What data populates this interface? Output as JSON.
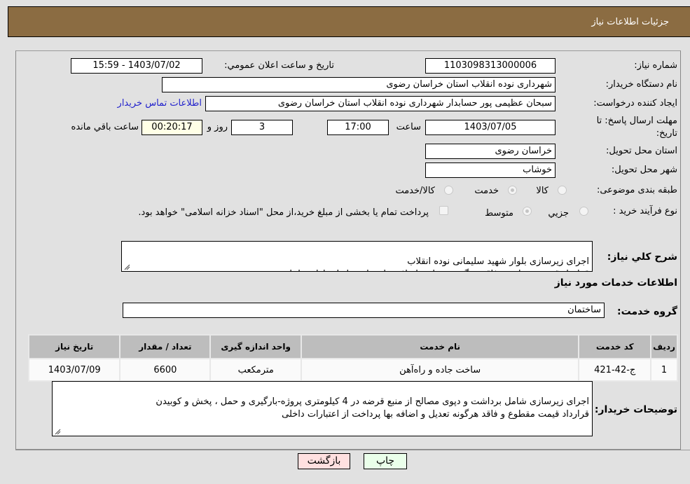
{
  "header": {
    "title": "جزئیات اطلاعات نیاز"
  },
  "fields": {
    "need_number": {
      "label": "شماره نیاز:",
      "value": "1103098313000006"
    },
    "announce_datetime": {
      "label": "تاریخ و ساعت اعلان عمومي:",
      "value": "1403/07/02 - 15:59"
    },
    "buyer_org": {
      "label": "نام دستگاه خریدار:",
      "value": "شهرداری نوده انقلاب استان خراسان رضوی"
    },
    "requester": {
      "label": "ایجاد کننده درخواست:",
      "value": "سبحان عظیمی پور حسابدار شهرداری نوده انقلاب استان خراسان رضوی"
    },
    "buyer_contact_link": "اطلاعات تماس خریدار",
    "deadline": {
      "label_line1": "مهلت ارسال پاسخ: تا",
      "label_line2": "تاریخ:",
      "date": "1403/07/05",
      "time_label": "ساعت",
      "time": "17:00",
      "days": "3",
      "days_label": "روز و",
      "remaining": "00:20:17",
      "remaining_label": "ساعت باقي مانده"
    },
    "province": {
      "label": "استان محل تحویل:",
      "value": "خراسان رضوی"
    },
    "city": {
      "label": "شهر محل تحویل:",
      "value": "خوشاب"
    },
    "category": {
      "label": "طبقه بندی موضوعی:",
      "options": [
        {
          "label": "کالا",
          "checked": false
        },
        {
          "label": "خدمت",
          "checked": true
        },
        {
          "label": "کالا/خدمت",
          "checked": false
        }
      ]
    },
    "purchase_type": {
      "label": "نوع فرآیند خرید :",
      "options": [
        {
          "label": "جزيي",
          "checked": false
        },
        {
          "label": "متوسط",
          "checked": true
        }
      ],
      "treasury_note": "پرداخت تمام یا بخشی از مبلغ خرید،از محل \"اسناد خزانه اسلامی\" خواهد بود."
    }
  },
  "description": {
    "label": "شرح کلي نیاز:",
    "value": "اجرای زیرسازی بلوار شهید سلیمانی نوده انقلاب\nقرارداد قیمت مقطوع و فاقد هرگونه تعدیل و اضافه بها پرداخت از اعتبارات داخلی"
  },
  "services_section_title": "اطلاعات خدمات مورد نیاز",
  "service_group": {
    "label": "گروه خدمت:",
    "value": "ساختمان"
  },
  "table": {
    "headers": [
      "ردیف",
      "کد خدمت",
      "نام خدمت",
      "واحد اندازه گیری",
      "تعداد / مقدار",
      "تاریخ نیاز"
    ],
    "rows": [
      [
        "1",
        "ج-42-421",
        "ساخت جاده و راه‌آهن",
        "مترمکعب",
        "6600",
        "1403/07/09"
      ]
    ]
  },
  "buyer_notes": {
    "label": "توضیحات خریدار:",
    "value": "اجرای زیرسازی شامل برداشت و دپوی مصالح از منبع قرضه در 4 کیلومتری پروژه-بارگیری و حمل ، پخش و کوبیدن\nقرارداد قیمت مقطوع و فاقد هرگونه تعدیل و اضافه بها پرداخت از اعتبارات داخلی"
  },
  "buttons": {
    "print": "چاپ",
    "back": "بازگشت"
  },
  "colors": {
    "header_bg": "#8b6c42",
    "print_bg": "#eaffea",
    "back_bg": "#ffe0e0",
    "link": "#2222cc",
    "remaining_bg": "#ffffe6"
  }
}
